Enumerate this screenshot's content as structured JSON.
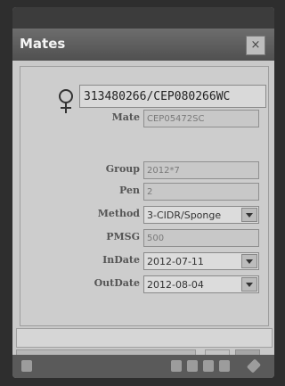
{
  "window": {
    "title": "Mates",
    "close_label": "×"
  },
  "animal": {
    "sex_icon": "female-icon",
    "id": "313480266/CEP080266WC"
  },
  "form": {
    "mate": {
      "label": "Mate",
      "value": "CEP05472SC"
    },
    "group": {
      "label": "Group",
      "value": "2012*7"
    },
    "pen": {
      "label": "Pen",
      "value": "2"
    },
    "method": {
      "label": "Method",
      "value": "3-CIDR/Sponge"
    },
    "pmsg": {
      "label": "PMSG",
      "value": "500"
    },
    "in_date": {
      "label": "InDate",
      "value": "2012-07-11"
    },
    "out_date": {
      "label": "OutDate",
      "value": "2012-08-04"
    }
  },
  "status": {
    "message": ""
  },
  "taskbar": {
    "icons": [
      "start-icon",
      "keyboard-icon",
      "notes-icon",
      "copy-icon",
      "sync-icon",
      "pen-icon"
    ]
  }
}
